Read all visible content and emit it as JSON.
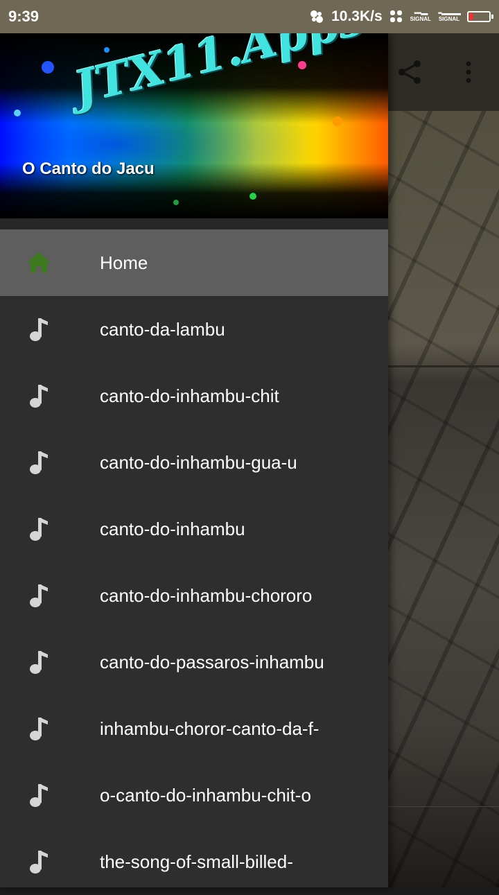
{
  "status_bar": {
    "time": "9:39",
    "network_speed": "10.3K/s",
    "signal_label_1": "SIGNAL",
    "signal_label_2": "SIGNAL"
  },
  "toolbar": {
    "share_icon": "share-icon",
    "more_icon": "more-vert-icon"
  },
  "drawer": {
    "brand": "JTX11.Apps",
    "subtitle": "O Canto do Jacu",
    "items": [
      {
        "label": "Home",
        "icon": "home-icon",
        "active": true
      },
      {
        "label": "canto-da-lambu",
        "icon": "music-note-icon"
      },
      {
        "label": "canto-do-inhambu-chit",
        "icon": "music-note-icon"
      },
      {
        "label": "canto-do-inhambu-gua-u",
        "icon": "music-note-icon"
      },
      {
        "label": "canto-do-inhambu",
        "icon": "music-note-icon"
      },
      {
        "label": "canto-do-inhambu-chororo",
        "icon": "music-note-icon"
      },
      {
        "label": "canto-do-passaros-inhambu",
        "icon": "music-note-icon"
      },
      {
        "label": "inhambu-choror-canto-da-f-",
        "icon": "music-note-icon"
      },
      {
        "label": "o-canto-do-inhambu-chit-o",
        "icon": "music-note-icon"
      },
      {
        "label": "the-song-of-small-billed-",
        "icon": "music-note-icon"
      }
    ]
  },
  "colors": {
    "home_icon": "#3c7a1e",
    "note_icon": "#d5d5d5",
    "drawer_bg": "#2e2e2e",
    "active_bg": "#5e5e5e",
    "brand_text": "#41e3df"
  }
}
